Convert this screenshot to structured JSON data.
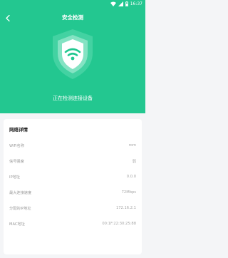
{
  "status_bar": {
    "time": "",
    "battery": "16:37"
  },
  "nav": {
    "title": "安全检测"
  },
  "scan": {
    "text": "正在检测连接设备"
  },
  "network_info": {
    "title": "网络详情",
    "rows": [
      {
        "label": "WiFi名称",
        "value": "rom"
      },
      {
        "label": "信号强度",
        "value": "弱"
      },
      {
        "label": "IP地址",
        "value": "0.0.0"
      },
      {
        "label": "最大连接速度",
        "value": "72Mbps"
      },
      {
        "label": "分配的IP地址",
        "value": "172.16.2.1"
      },
      {
        "label": "MAC地址",
        "value": "00:1F:22:30:25:88"
      }
    ]
  },
  "colors": {
    "primary": "#23c790",
    "background": "#f4f5f7"
  }
}
